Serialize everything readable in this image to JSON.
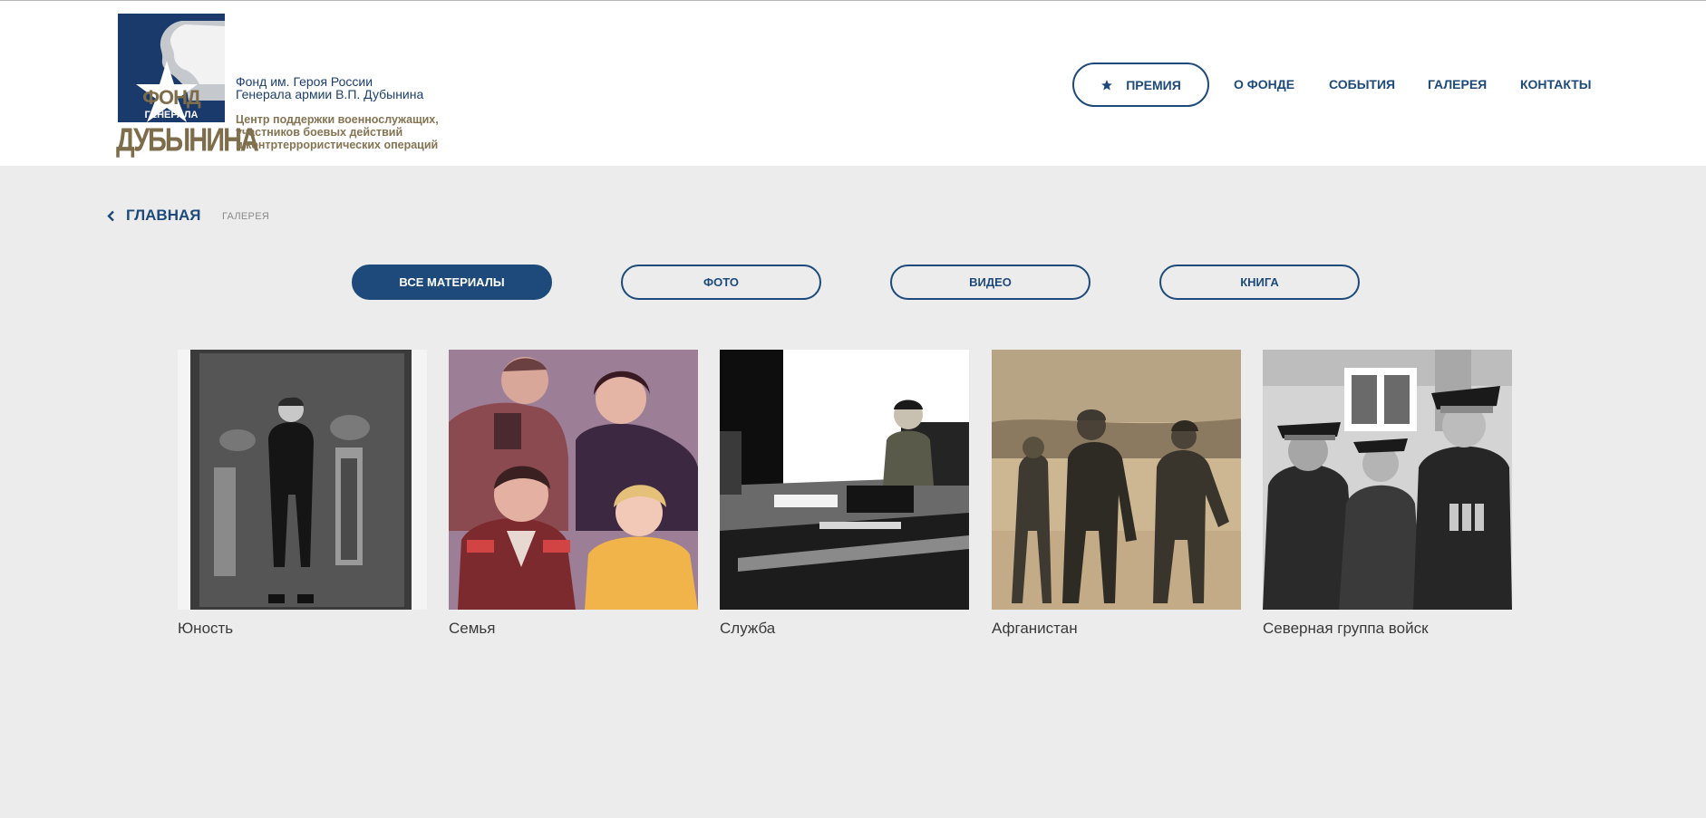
{
  "header": {
    "logo": {
      "word1": "ФОНД",
      "word2": "ГЕНЕРАЛА",
      "word3": "ДУБЫНИНА"
    },
    "org": {
      "line1": "Фонд им. Героя России",
      "line2": "Генерала армии В.П. Дубынина",
      "sub1": "Центр поддержки военнослужащих,",
      "sub2": "участников боевых действий",
      "sub3": "и контртеррористических операций"
    },
    "nav": {
      "prize": "ПРЕМИЯ",
      "about": "О ФОНДЕ",
      "events": "СОБЫТИЯ",
      "gallery": "ГАЛЕРЕЯ",
      "contacts": "КОНТАКТЫ"
    }
  },
  "breadcrumb": {
    "home": "ГЛАВНАЯ",
    "current": "ГАЛЕРЕЯ"
  },
  "filters": [
    {
      "label": "ВСЕ МАТЕРИАЛЫ",
      "active": true
    },
    {
      "label": "ФОТО",
      "active": false
    },
    {
      "label": "ВИДЕО",
      "active": false
    },
    {
      "label": "КНИГА",
      "active": false
    }
  ],
  "albums": [
    {
      "title": "Юность"
    },
    {
      "title": "Семья"
    },
    {
      "title": "Служба"
    },
    {
      "title": "Афганистан"
    },
    {
      "title": "Северная группа войск"
    }
  ],
  "colors": {
    "brand_blue": "#1d4a7a",
    "logo_navy": "#1a3a6c",
    "logo_gold": "#857452",
    "page_bg": "#ececec"
  }
}
